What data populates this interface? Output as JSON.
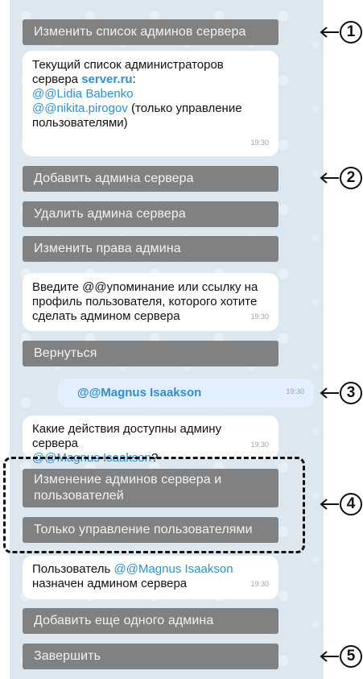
{
  "buttons": {
    "change_admin_list": "Изменить список админов сервера",
    "add_admin": "Добавить админа сервера",
    "remove_admin": "Удалить админа сервера",
    "change_rights": "Изменить права админа",
    "back": "Вернуться",
    "perm_full": "Изменение админов сервера и пользователей",
    "perm_users": "Только управление пользователями",
    "add_another": "Добавить еще одного админа",
    "finish": "Завершить"
  },
  "messages": {
    "m1": {
      "line1": "Текущий список администраторов",
      "line2_prefix": "сервера ",
      "server": "server.ru",
      "line2_suffix": ":",
      "admin1": "@@Lidia Babenko",
      "admin2": "@@nikita.pirogov",
      "admin2_note": " (только управление",
      "line5": "пользователями)",
      "time": "19:30"
    },
    "m2": {
      "line1": "Введите @@упоминание или ссылку на",
      "line2": "профиль пользователя, которого хотите",
      "line3": "сделать админом сервера",
      "time": "19:30"
    },
    "m3": {
      "mention": "@@Magnus Isaakson",
      "time": "19:30"
    },
    "m4": {
      "line1": "Какие действия доступны админу сервера",
      "mention": "@@Magnus Isaakson",
      "suffix": "?",
      "time": "19:30"
    },
    "m5": {
      "prefix": "Пользователь ",
      "mention": "@@Magnus Isaakson",
      "line2": "назначен админом сервера",
      "time": "19:30"
    }
  },
  "callouts": [
    "1",
    "2",
    "3",
    "4",
    "5"
  ]
}
